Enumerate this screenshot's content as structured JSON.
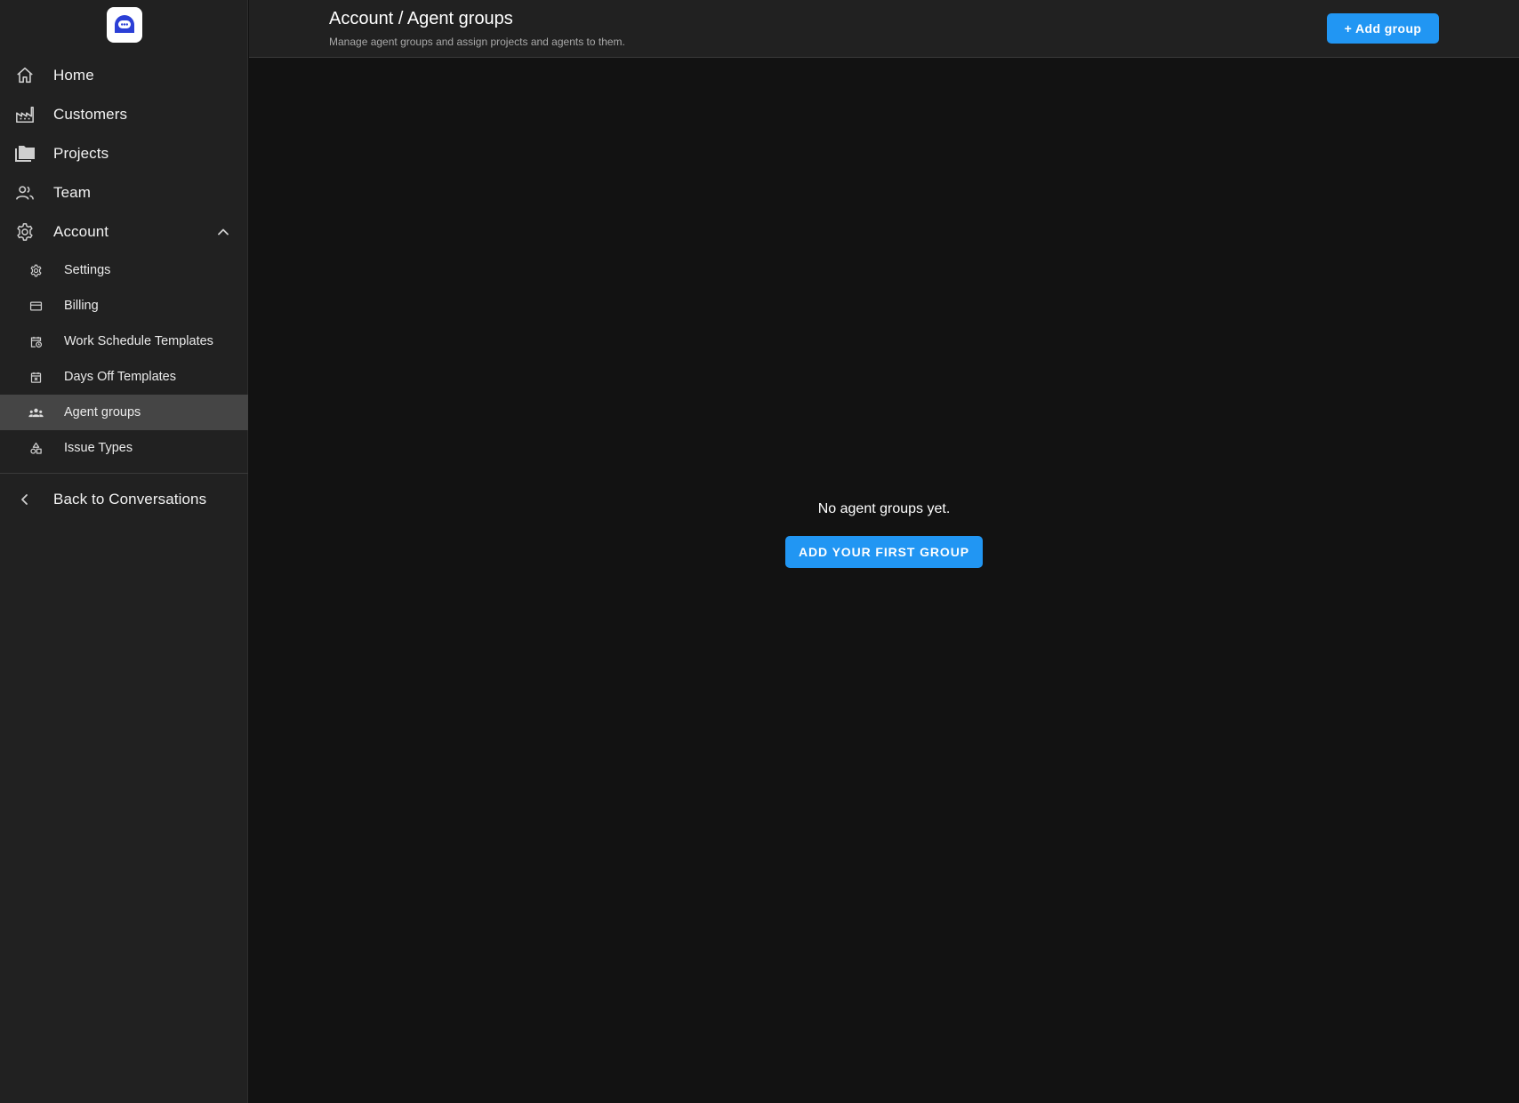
{
  "sidebar": {
    "nav": [
      {
        "label": "Home",
        "icon": "home-icon"
      },
      {
        "label": "Customers",
        "icon": "factory-icon"
      },
      {
        "label": "Projects",
        "icon": "folders-icon"
      },
      {
        "label": "Team",
        "icon": "team-icon"
      },
      {
        "label": "Account",
        "icon": "gear-icon",
        "expanded": true
      }
    ],
    "account_items": [
      {
        "label": "Settings",
        "icon": "gear-icon"
      },
      {
        "label": "Billing",
        "icon": "credit-card-icon"
      },
      {
        "label": "Work Schedule Templates",
        "icon": "calendar-clock-icon"
      },
      {
        "label": "Days Off Templates",
        "icon": "calendar-x-icon"
      },
      {
        "label": "Agent groups",
        "icon": "groups-icon",
        "active": true
      },
      {
        "label": "Issue Types",
        "icon": "shapes-icon"
      }
    ],
    "back_label": "Back to Conversations"
  },
  "header": {
    "title": "Account / Agent groups",
    "subtitle": "Manage agent groups and assign projects and agents to them.",
    "add_button": "+ Add group"
  },
  "main": {
    "empty_text": "No agent groups yet.",
    "first_button": "ADD YOUR FIRST GROUP"
  },
  "colors": {
    "accent": "#2196f3",
    "sidebar_bg": "#212121",
    "main_bg": "#121212",
    "active_item_bg": "#454545",
    "logo_blue": "#2b3fd6"
  }
}
